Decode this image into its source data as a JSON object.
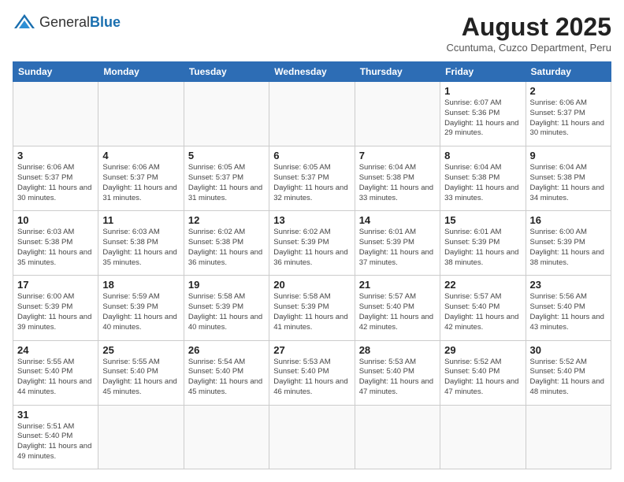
{
  "header": {
    "logo_general": "General",
    "logo_blue": "Blue",
    "month_year": "August 2025",
    "location": "Ccuntuma, Cuzco Department, Peru"
  },
  "weekdays": [
    "Sunday",
    "Monday",
    "Tuesday",
    "Wednesday",
    "Thursday",
    "Friday",
    "Saturday"
  ],
  "weeks": [
    [
      {
        "day": "",
        "info": ""
      },
      {
        "day": "",
        "info": ""
      },
      {
        "day": "",
        "info": ""
      },
      {
        "day": "",
        "info": ""
      },
      {
        "day": "",
        "info": ""
      },
      {
        "day": "1",
        "info": "Sunrise: 6:07 AM\nSunset: 5:36 PM\nDaylight: 11 hours\nand 29 minutes."
      },
      {
        "day": "2",
        "info": "Sunrise: 6:06 AM\nSunset: 5:37 PM\nDaylight: 11 hours\nand 30 minutes."
      }
    ],
    [
      {
        "day": "3",
        "info": "Sunrise: 6:06 AM\nSunset: 5:37 PM\nDaylight: 11 hours\nand 30 minutes."
      },
      {
        "day": "4",
        "info": "Sunrise: 6:06 AM\nSunset: 5:37 PM\nDaylight: 11 hours\nand 31 minutes."
      },
      {
        "day": "5",
        "info": "Sunrise: 6:05 AM\nSunset: 5:37 PM\nDaylight: 11 hours\nand 31 minutes."
      },
      {
        "day": "6",
        "info": "Sunrise: 6:05 AM\nSunset: 5:37 PM\nDaylight: 11 hours\nand 32 minutes."
      },
      {
        "day": "7",
        "info": "Sunrise: 6:04 AM\nSunset: 5:38 PM\nDaylight: 11 hours\nand 33 minutes."
      },
      {
        "day": "8",
        "info": "Sunrise: 6:04 AM\nSunset: 5:38 PM\nDaylight: 11 hours\nand 33 minutes."
      },
      {
        "day": "9",
        "info": "Sunrise: 6:04 AM\nSunset: 5:38 PM\nDaylight: 11 hours\nand 34 minutes."
      }
    ],
    [
      {
        "day": "10",
        "info": "Sunrise: 6:03 AM\nSunset: 5:38 PM\nDaylight: 11 hours\nand 35 minutes."
      },
      {
        "day": "11",
        "info": "Sunrise: 6:03 AM\nSunset: 5:38 PM\nDaylight: 11 hours\nand 35 minutes."
      },
      {
        "day": "12",
        "info": "Sunrise: 6:02 AM\nSunset: 5:38 PM\nDaylight: 11 hours\nand 36 minutes."
      },
      {
        "day": "13",
        "info": "Sunrise: 6:02 AM\nSunset: 5:39 PM\nDaylight: 11 hours\nand 36 minutes."
      },
      {
        "day": "14",
        "info": "Sunrise: 6:01 AM\nSunset: 5:39 PM\nDaylight: 11 hours\nand 37 minutes."
      },
      {
        "day": "15",
        "info": "Sunrise: 6:01 AM\nSunset: 5:39 PM\nDaylight: 11 hours\nand 38 minutes."
      },
      {
        "day": "16",
        "info": "Sunrise: 6:00 AM\nSunset: 5:39 PM\nDaylight: 11 hours\nand 38 minutes."
      }
    ],
    [
      {
        "day": "17",
        "info": "Sunrise: 6:00 AM\nSunset: 5:39 PM\nDaylight: 11 hours\nand 39 minutes."
      },
      {
        "day": "18",
        "info": "Sunrise: 5:59 AM\nSunset: 5:39 PM\nDaylight: 11 hours\nand 40 minutes."
      },
      {
        "day": "19",
        "info": "Sunrise: 5:58 AM\nSunset: 5:39 PM\nDaylight: 11 hours\nand 40 minutes."
      },
      {
        "day": "20",
        "info": "Sunrise: 5:58 AM\nSunset: 5:39 PM\nDaylight: 11 hours\nand 41 minutes."
      },
      {
        "day": "21",
        "info": "Sunrise: 5:57 AM\nSunset: 5:40 PM\nDaylight: 11 hours\nand 42 minutes."
      },
      {
        "day": "22",
        "info": "Sunrise: 5:57 AM\nSunset: 5:40 PM\nDaylight: 11 hours\nand 42 minutes."
      },
      {
        "day": "23",
        "info": "Sunrise: 5:56 AM\nSunset: 5:40 PM\nDaylight: 11 hours\nand 43 minutes."
      }
    ],
    [
      {
        "day": "24",
        "info": "Sunrise: 5:55 AM\nSunset: 5:40 PM\nDaylight: 11 hours\nand 44 minutes."
      },
      {
        "day": "25",
        "info": "Sunrise: 5:55 AM\nSunset: 5:40 PM\nDaylight: 11 hours\nand 45 minutes."
      },
      {
        "day": "26",
        "info": "Sunrise: 5:54 AM\nSunset: 5:40 PM\nDaylight: 11 hours\nand 45 minutes."
      },
      {
        "day": "27",
        "info": "Sunrise: 5:53 AM\nSunset: 5:40 PM\nDaylight: 11 hours\nand 46 minutes."
      },
      {
        "day": "28",
        "info": "Sunrise: 5:53 AM\nSunset: 5:40 PM\nDaylight: 11 hours\nand 47 minutes."
      },
      {
        "day": "29",
        "info": "Sunrise: 5:52 AM\nSunset: 5:40 PM\nDaylight: 11 hours\nand 47 minutes."
      },
      {
        "day": "30",
        "info": "Sunrise: 5:52 AM\nSunset: 5:40 PM\nDaylight: 11 hours\nand 48 minutes."
      }
    ],
    [
      {
        "day": "31",
        "info": "Sunrise: 5:51 AM\nSunset: 5:40 PM\nDaylight: 11 hours\nand 49 minutes."
      },
      {
        "day": "",
        "info": ""
      },
      {
        "day": "",
        "info": ""
      },
      {
        "day": "",
        "info": ""
      },
      {
        "day": "",
        "info": ""
      },
      {
        "day": "",
        "info": ""
      },
      {
        "day": "",
        "info": ""
      }
    ]
  ]
}
